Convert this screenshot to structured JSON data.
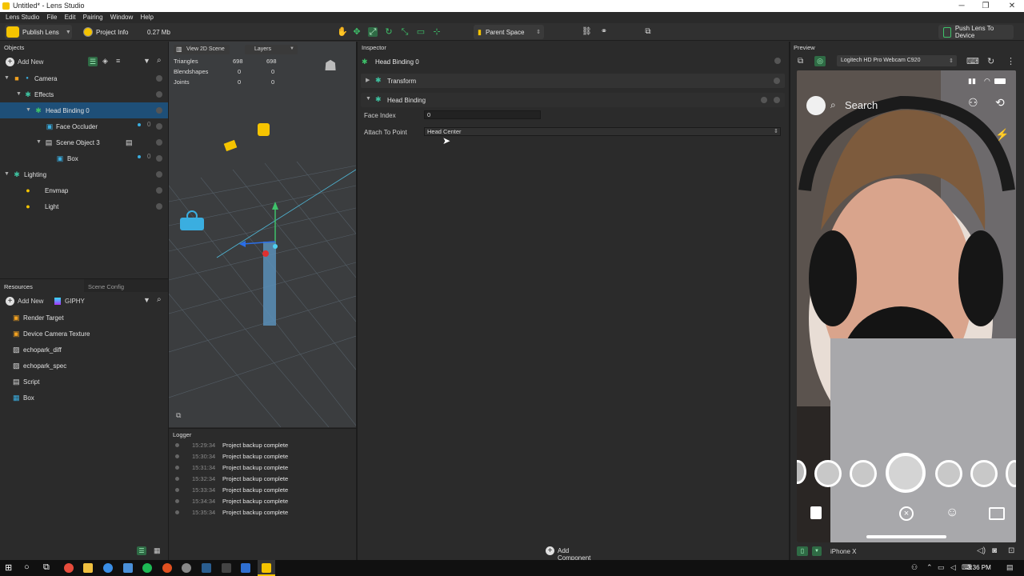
{
  "window": {
    "title": "Untitled* - Lens Studio",
    "minimize": "─",
    "maximize": "❐",
    "close": "✕"
  },
  "menu": [
    "Lens Studio",
    "File",
    "Edit",
    "Pairing",
    "Window",
    "Help"
  ],
  "toolbar": {
    "publish_label": "Publish Lens",
    "project_info_label": "Project Info",
    "size_label": "0.27 Mb",
    "space_label": "Parent Space",
    "push_label": "Push Lens To Device"
  },
  "objects": {
    "title": "Objects",
    "add_new": "Add New",
    "items": [
      {
        "label": "Camera",
        "depth": 0
      },
      {
        "label": "Effects",
        "depth": 1
      },
      {
        "label": "Head Binding 0",
        "depth": 2
      },
      {
        "label": "Face Occluder",
        "depth": 3,
        "count": "0"
      },
      {
        "label": "Scene Object 3",
        "depth": 3
      },
      {
        "label": "Box",
        "depth": 4,
        "count": "0"
      },
      {
        "label": "Lighting",
        "depth": 0
      },
      {
        "label": "Envmap",
        "depth": 1
      },
      {
        "label": "Light",
        "depth": 1
      }
    ]
  },
  "resources": {
    "title": "Resources",
    "tab2": "Scene Config",
    "add_new": "Add New",
    "giphy": "GIPHY",
    "items": [
      "Render Target",
      "Device Camera Texture",
      "echopark_diff",
      "echopark_spec",
      "Script",
      "Box"
    ]
  },
  "scene": {
    "view_label": "View 2D Scene",
    "layers_label": "Layers",
    "stats": [
      {
        "label": "Triangles",
        "a": "698",
        "b": "698"
      },
      {
        "label": "Blendshapes",
        "a": "0",
        "b": "0"
      },
      {
        "label": "Joints",
        "a": "0",
        "b": "0"
      }
    ]
  },
  "logger": {
    "title": "Logger",
    "entries": [
      {
        "time": "15:29:34",
        "msg": "Project backup complete"
      },
      {
        "time": "15:30:34",
        "msg": "Project backup complete"
      },
      {
        "time": "15:31:34",
        "msg": "Project backup complete"
      },
      {
        "time": "15:32:34",
        "msg": "Project backup complete"
      },
      {
        "time": "15:33:34",
        "msg": "Project backup complete"
      },
      {
        "time": "15:34:34",
        "msg": "Project backup complete"
      },
      {
        "time": "15:35:34",
        "msg": "Project backup complete"
      }
    ]
  },
  "inspector": {
    "title": "Inspector",
    "object_name": "Head Binding 0",
    "transform_label": "Transform",
    "component_label": "Head Binding",
    "face_index_label": "Face Index",
    "face_index_value": "0",
    "attach_label": "Attach To Point",
    "attach_value": "Head Center",
    "add_component": "Add Component"
  },
  "preview": {
    "title": "Preview",
    "camera_source": "Logitech HD Pro Webcam C920",
    "search_placeholder": "Search",
    "device_label": "iPhone X"
  },
  "taskbar": {
    "clock": "3:36 PM"
  },
  "colors": {
    "accent": "#3ec26a",
    "selection": "#1e4f78",
    "brand_yellow": "#f5c400"
  }
}
